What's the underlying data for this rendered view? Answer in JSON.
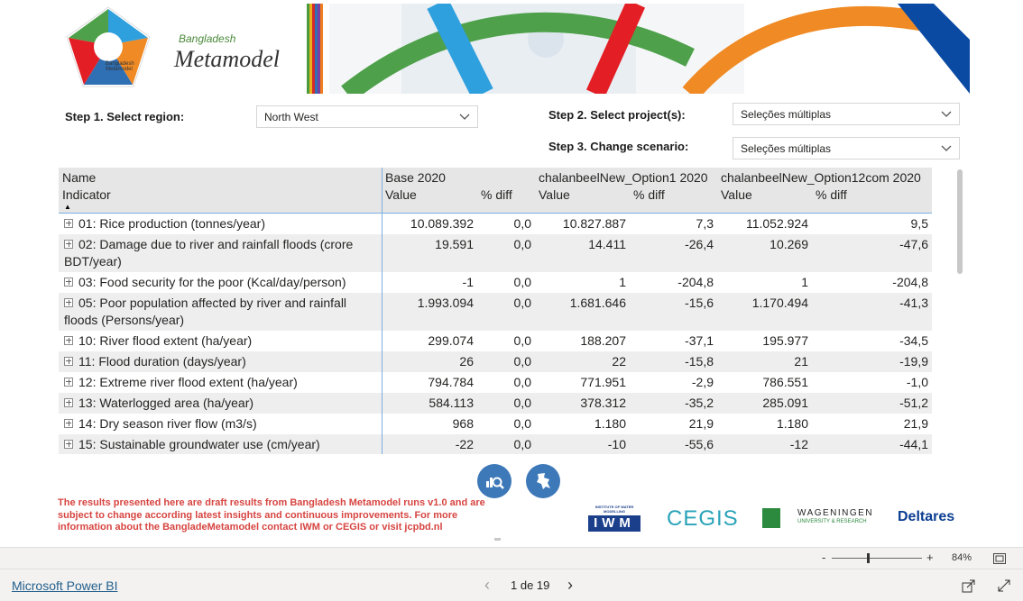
{
  "banner": {
    "logo_text_line1": "Bangladesh",
    "logo_text_line2": "Metamodel",
    "logo_small_text": "Bangladesh Metamodel"
  },
  "steps": {
    "step1": {
      "label": "Step 1. Select region:",
      "value": "North West"
    },
    "step2": {
      "label": "Step 2. Select project(s):",
      "value": "Seleções múltiplas"
    },
    "step3": {
      "label": "Step 3. Change scenario:",
      "value": "Seleções múltiplas"
    }
  },
  "table": {
    "header_row1": [
      "Name",
      "Base 2020",
      "",
      "chalanbeelNew_Option1 2020",
      "",
      "chalanbeelNew_Option12com 2020",
      ""
    ],
    "header_row2": [
      "Indicator",
      "Value",
      "% diff",
      "Value",
      "% diff",
      "Value",
      "% diff"
    ],
    "rows": [
      {
        "name": "01: Rice production (tonnes/year)",
        "v": [
          "10.089.392",
          "0,0",
          "10.827.887",
          "7,3",
          "11.052.924",
          "9,5"
        ]
      },
      {
        "name": "02: Damage due to river and rainfall floods (crore BDT/year)",
        "v": [
          "19.591",
          "0,0",
          "14.411",
          "-26,4",
          "10.269",
          "-47,6"
        ]
      },
      {
        "name": "03: Food security for the poor (Kcal/day/person)",
        "v": [
          "-1",
          "0,0",
          "1",
          "-204,8",
          "1",
          "-204,8"
        ]
      },
      {
        "name": "05: Poor population affected by river and rainfall floods (Persons/year)",
        "v": [
          "1.993.094",
          "0,0",
          "1.681.646",
          "-15,6",
          "1.170.494",
          "-41,3"
        ]
      },
      {
        "name": "10: River flood extent (ha/year)",
        "v": [
          "299.074",
          "0,0",
          "188.207",
          "-37,1",
          "195.977",
          "-34,5"
        ]
      },
      {
        "name": "11: Flood duration (days/year)",
        "v": [
          "26",
          "0,0",
          "22",
          "-15,8",
          "21",
          "-19,9"
        ]
      },
      {
        "name": "12: Extreme river flood extent (ha/year)",
        "v": [
          "794.784",
          "0,0",
          "771.951",
          "-2,9",
          "786.551",
          "-1,0"
        ]
      },
      {
        "name": "13: Waterlogged area (ha/year)",
        "v": [
          "584.113",
          "0,0",
          "378.312",
          "-35,2",
          "285.091",
          "-51,2"
        ]
      },
      {
        "name": "14: Dry season river flow (m3/s)",
        "v": [
          "968",
          "0,0",
          "1.180",
          "21,9",
          "1.180",
          "21,9"
        ]
      },
      {
        "name": "15: Sustainable groundwater use (cm/year)",
        "v": [
          "-22",
          "0,0",
          "-10",
          "-55,6",
          "-12",
          "-44,1"
        ]
      }
    ]
  },
  "disclaimer": "The results presented here are draft results from Bangladesh Metamodel runs v1.0 and are subject to change according latest insights and continuous improvements. For more information about the BangladeMetamodel contact IWM or CEGIS or visit jcpbd.nl",
  "partners": {
    "iwm_small": "INSTITUTE OF WATER MODELLING",
    "iwm": "IWM",
    "cegis": "CEGIS",
    "wageningen_line1": "WAGENINGEN",
    "wageningen_line2": "UNIVERSITY & RESEARCH",
    "deltares": "Deltares"
  },
  "footer": {
    "zoom_minus": "-",
    "zoom_plus": "+",
    "zoom_level": "84%",
    "zoom_fraction": 0.4,
    "brand_link": "Microsoft Power BI",
    "page_indicator": "1 de 19",
    "prev": "‹",
    "next": "›"
  },
  "colors": {
    "accent_blue": "#3d78b8",
    "disclaimer_red": "#d64541",
    "link_blue": "#235f8c"
  }
}
